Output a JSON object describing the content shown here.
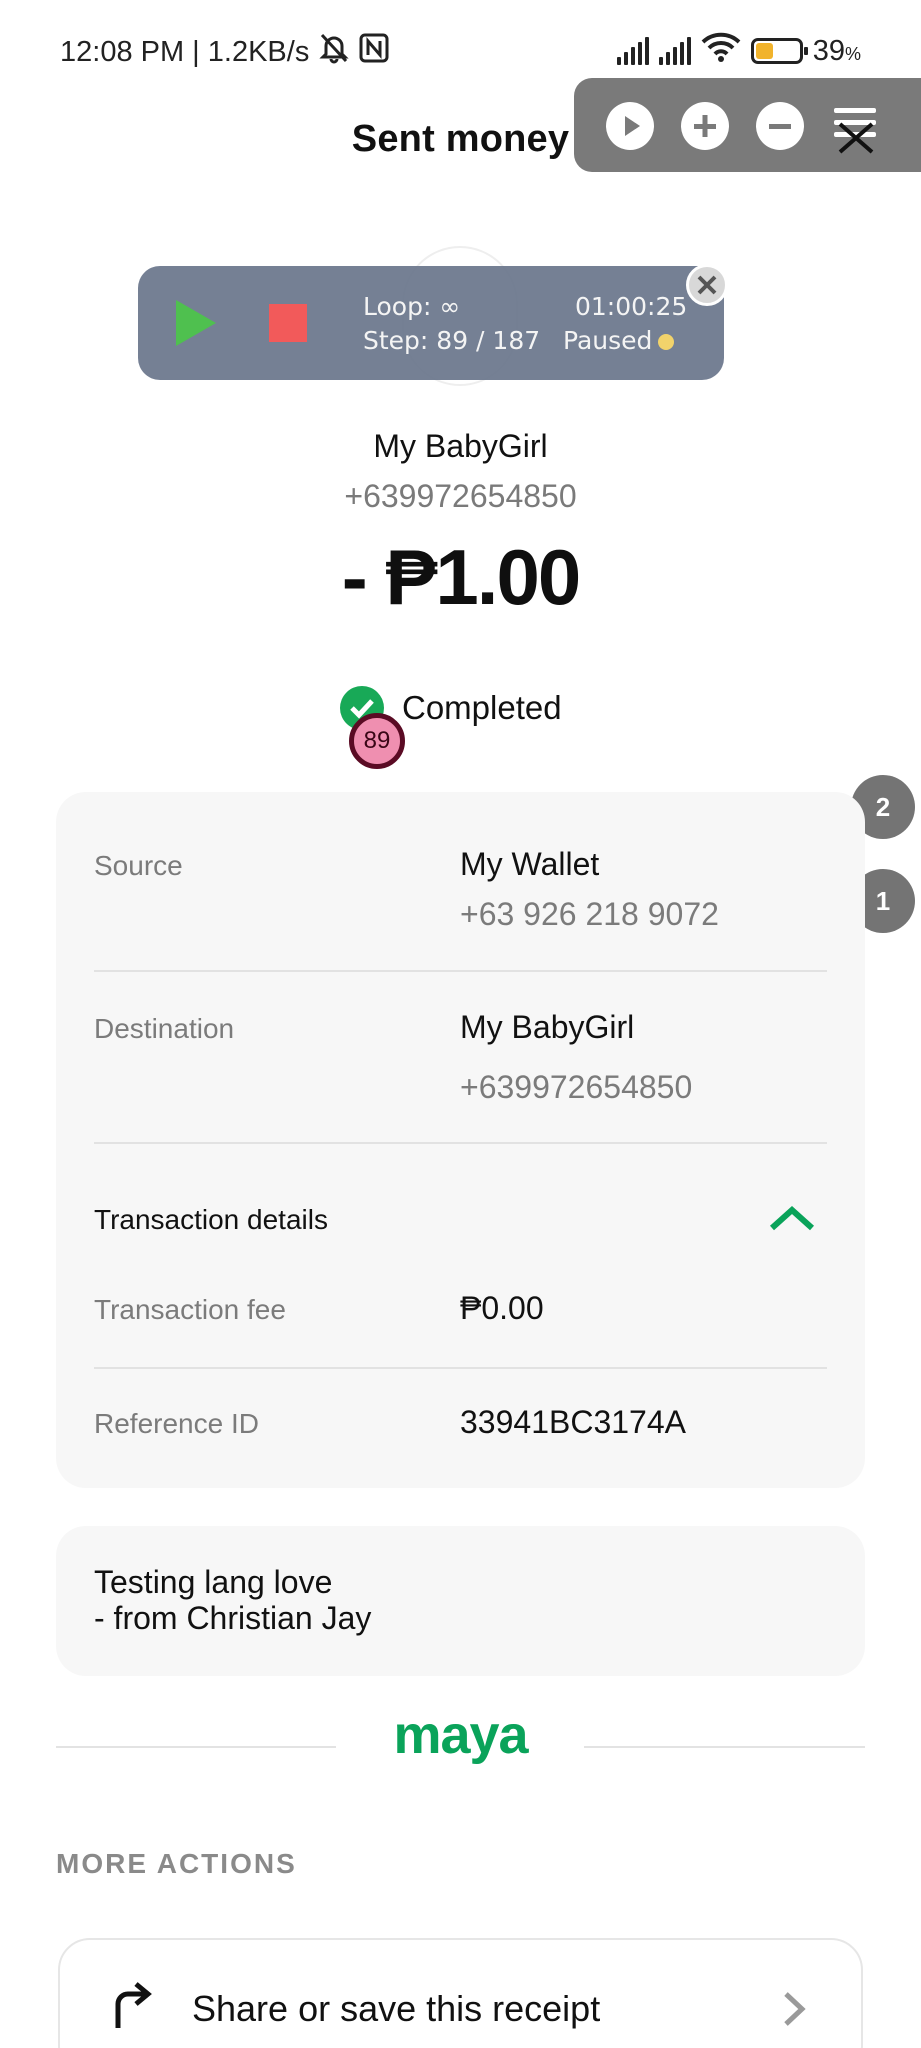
{
  "status_bar": {
    "time_speed": "12:08 PM | 1.2KB/s",
    "battery_pct": "39",
    "battery_unit": "%",
    "battery_level": 0.39
  },
  "header": {
    "title": "Sent money"
  },
  "float_controls": {
    "icons": [
      "play-icon",
      "plus-icon",
      "minus-icon",
      "menu-close-icon"
    ]
  },
  "macro": {
    "loop": "Loop: ∞",
    "time": "01:00:25",
    "step": "Step: 89 / 187",
    "state": "Paused"
  },
  "recipient": {
    "name": "My BabyGirl",
    "phone": "+639972654850"
  },
  "amount": "- ₱1.00",
  "status": {
    "label": "Completed",
    "step_badge": "89"
  },
  "side_badges": [
    "2",
    "1"
  ],
  "details": {
    "source_label": "Source",
    "source_name": "My Wallet",
    "source_number": "+63 926 218 9072",
    "destination_label": "Destination",
    "destination_name": "My BabyGirl",
    "destination_number": "+639972654850",
    "transaction_details_title": "Transaction details",
    "fee_label": "Transaction fee",
    "fee_value": "₱0.00",
    "reference_label": "Reference ID",
    "reference_value": "33941BC3174A"
  },
  "note": {
    "line1": "Testing lang love",
    "line2": "- from Christian Jay"
  },
  "brand": "maya",
  "more_actions": {
    "title": "MORE ACTIONS",
    "share_label": "Share or save this receipt"
  },
  "colors": {
    "accent_green": "#0aa35a",
    "check_green": "#18a957",
    "macro_bg": "#6a768c",
    "float_bg": "#7a7a7a"
  }
}
